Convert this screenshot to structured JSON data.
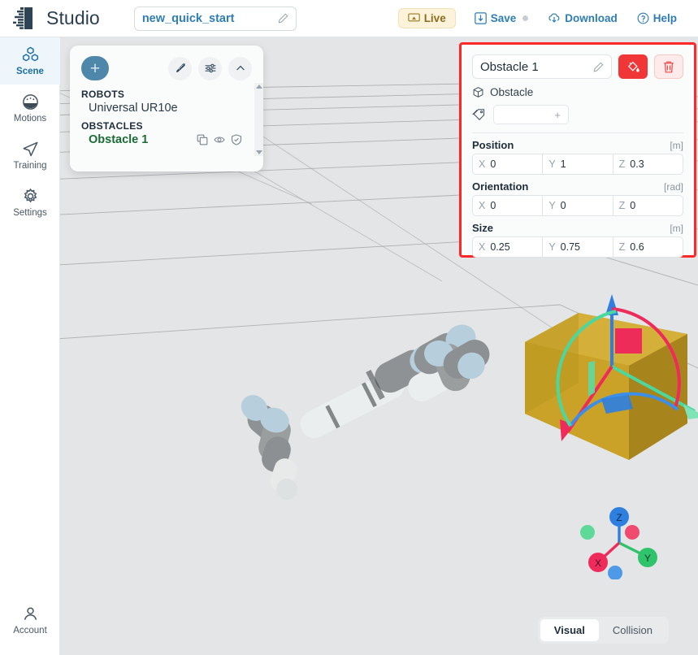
{
  "topbar": {
    "brand": "Studio",
    "project_name": "new_quick_start",
    "edit_icon": "pencil-icon",
    "live_label": "Live",
    "save_label": "Save",
    "download_label": "Download",
    "help_label": "Help"
  },
  "sidebar": {
    "items": [
      {
        "label": "Scene",
        "icon": "cubes-icon",
        "active": true
      },
      {
        "label": "Motions",
        "icon": "gauge-icon",
        "active": false
      },
      {
        "label": "Training",
        "icon": "paper-plane-icon",
        "active": false
      },
      {
        "label": "Settings",
        "icon": "gear-icon",
        "active": false
      }
    ],
    "account": {
      "label": "Account",
      "icon": "user-icon"
    }
  },
  "scene_tree": {
    "add_label": "+",
    "tool_icons": [
      "ruler-icon",
      "sliders-icon",
      "chevron-up-icon"
    ],
    "groups": [
      {
        "title": "ROBOTS",
        "items": [
          {
            "label": "Universal UR10e",
            "selected": false
          }
        ]
      },
      {
        "title": "OBSTACLES",
        "items": [
          {
            "label": "Obstacle 1",
            "selected": true
          }
        ]
      }
    ],
    "row_icons": [
      "copy-icon",
      "eye-icon",
      "shield-check-icon"
    ]
  },
  "properties": {
    "name": "Obstacle 1",
    "type_label": "Obstacle",
    "type_icon": "cube-icon",
    "tag_placeholder": "",
    "tag_add": "+",
    "color_button_icon": "paint-bucket-icon",
    "delete_button_icon": "trash-icon",
    "accent_color": "#f03636",
    "highlight_border": "#fd2828",
    "sections": [
      {
        "label": "Position",
        "unit": "[m]",
        "fields": [
          {
            "axis": "X",
            "value": "0"
          },
          {
            "axis": "Y",
            "value": "1"
          },
          {
            "axis": "Z",
            "value": "0.3"
          }
        ]
      },
      {
        "label": "Orientation",
        "unit": "[rad]",
        "fields": [
          {
            "axis": "X",
            "value": "0"
          },
          {
            "axis": "Y",
            "value": "0"
          },
          {
            "axis": "Z",
            "value": "0"
          }
        ]
      },
      {
        "label": "Size",
        "unit": "[m]",
        "fields": [
          {
            "axis": "X",
            "value": "0.25"
          },
          {
            "axis": "Y",
            "value": "0.75"
          },
          {
            "axis": "Z",
            "value": "0.6"
          }
        ]
      }
    ]
  },
  "viewport": {
    "gizmo": {
      "axes": [
        {
          "label": "Z",
          "color": "#2f7fe0"
        },
        {
          "label": "X",
          "color": "#ef2b5b"
        },
        {
          "label": "Y",
          "color": "#2fc46b"
        }
      ]
    },
    "view_toggle": {
      "visual_label": "Visual",
      "collision_label": "Collision",
      "selected": "Visual"
    },
    "objects": {
      "robot": "Universal UR10e",
      "obstacle_color": "#c9a227"
    }
  }
}
